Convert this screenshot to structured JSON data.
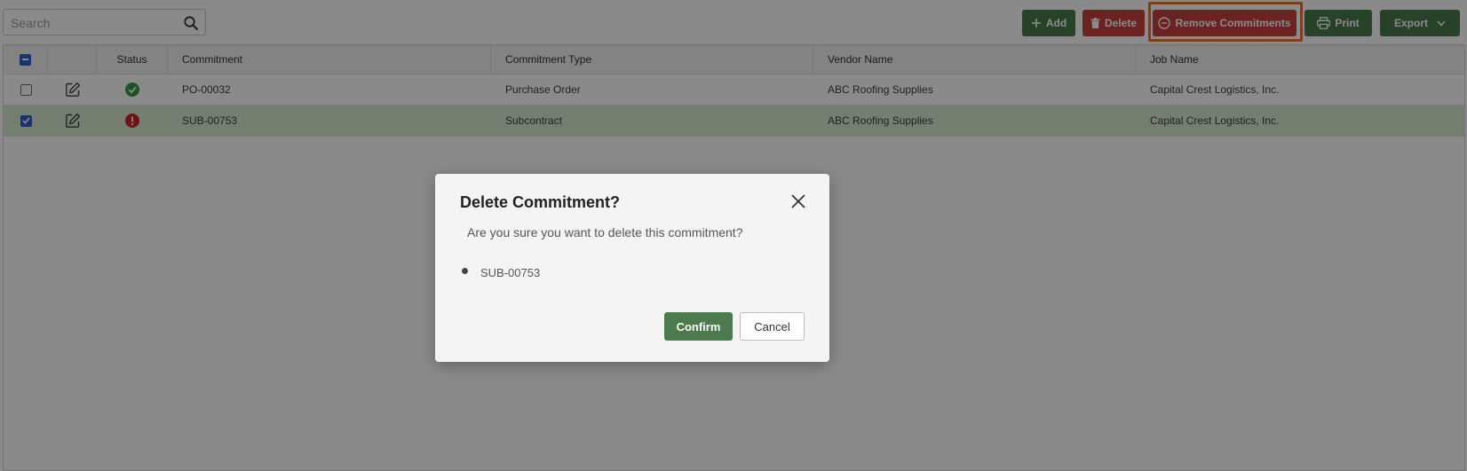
{
  "toolbar": {
    "search_placeholder": "Search",
    "add_label": "Add",
    "delete_label": "Delete",
    "remove_label": "Remove Commitments",
    "print_label": "Print",
    "export_label": "Export"
  },
  "table": {
    "headers": {
      "status": "Status",
      "commitment": "Commitment",
      "type": "Commitment Type",
      "vendor": "Vendor Name",
      "job": "Job Name"
    },
    "rows": [
      {
        "selected": false,
        "status": "ok",
        "commitment": "PO-00032",
        "type": "Purchase Order",
        "vendor": "ABC Roofing Supplies",
        "job": "Capital Crest Logistics, Inc."
      },
      {
        "selected": true,
        "status": "error",
        "commitment": "SUB-00753",
        "type": "Subcontract",
        "vendor": "ABC Roofing Supplies",
        "job": "Capital Crest Logistics, Inc."
      }
    ]
  },
  "dialog": {
    "title": "Delete Commitment?",
    "message": "Are you sure you want to delete this commitment?",
    "items": [
      "SUB-00753"
    ],
    "confirm_label": "Confirm",
    "cancel_label": "Cancel"
  },
  "colors": {
    "primary_green": "#4b7a4e",
    "danger_red": "#c8403d",
    "highlight_orange": "#e6772e",
    "selected_row": "#d7ebd1",
    "checkbox_blue": "#2f5fd0",
    "status_ok": "#3a9a45",
    "status_error": "#c62828"
  },
  "icons": {
    "search": "search-icon",
    "add": "plus-icon",
    "delete": "trash-icon",
    "remove": "minus-circle-icon",
    "print": "printer-icon",
    "export": "chevron-down-icon",
    "edit": "edit-icon",
    "status_ok": "check-circle-icon",
    "status_error": "alert-circle-icon",
    "close": "close-icon"
  }
}
